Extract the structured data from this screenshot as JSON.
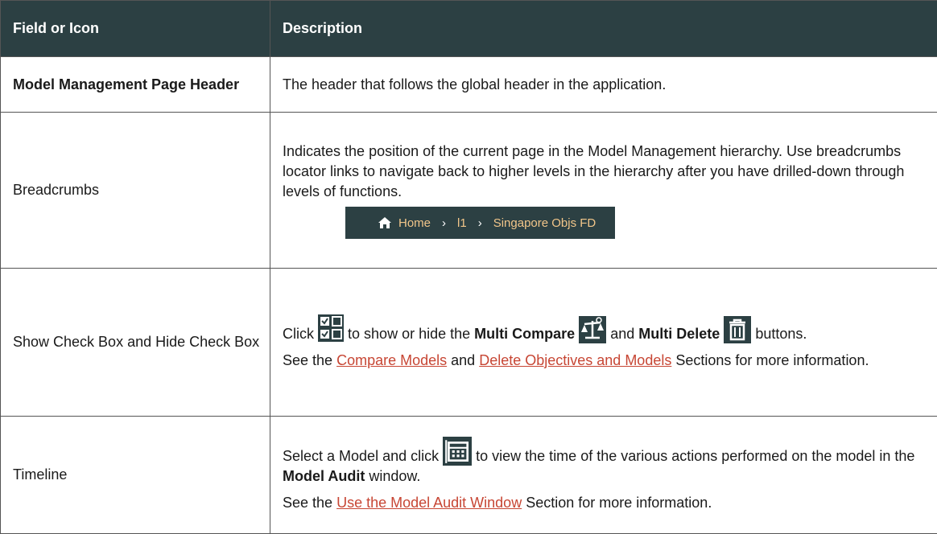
{
  "table": {
    "header": {
      "col1": "Field or Icon",
      "col2": "Description"
    },
    "rows": {
      "header_row": {
        "field": "Model Management Page Header",
        "desc": "The header that follows the global header in the application."
      },
      "breadcrumbs": {
        "field": "Breadcrumbs",
        "desc": "Indicates the position of the current page in the Model Management hierarchy. Use breadcrumbs locator links to navigate back to higher levels in the hierarchy after you have drilled-down through levels of functions.",
        "bar": {
          "home": "Home",
          "item1": "l1",
          "item2": "Singapore Objs FD"
        }
      },
      "checkbox": {
        "field": "Show Check Box and Hide Check Box",
        "click": "Click",
        "mid": "to show or hide the",
        "multi_compare": "Multi Compare",
        "and": "and",
        "multi_delete": "Multi Delete",
        "tail": "buttons.",
        "see": "See the",
        "link1": "Compare Models",
        "and2": "and",
        "link2": "Delete Objectives and Models",
        "see_tail": "Sections for more information."
      },
      "timeline": {
        "field": "Timeline",
        "pre": "Select a Model and click",
        "post": "to view the time of the various actions performed on the model in the",
        "bold": "Model Audit",
        "end": "window.",
        "see": "See the",
        "link": "Use the Model Audit Window",
        "see_tail": "Section for more information."
      }
    }
  },
  "colors": {
    "header_bg": "#2c4043",
    "link": "#c74634",
    "breadcrumb_text": "#f2c68a"
  },
  "icons": [
    "home-icon",
    "checkbox-grid-icon",
    "multi-compare-icon",
    "multi-delete-icon",
    "timeline-icon"
  ]
}
